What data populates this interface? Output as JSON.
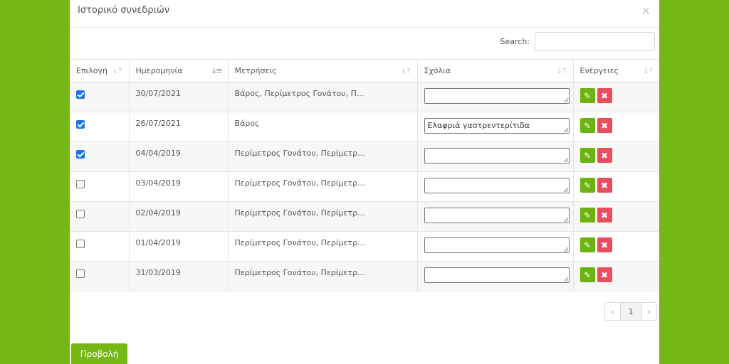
{
  "modal": {
    "title": "Ιστορικό συνεδριών",
    "close_icon": "×"
  },
  "search": {
    "label": "Search:",
    "value": "",
    "placeholder": ""
  },
  "table": {
    "columns": [
      "Επιλογή",
      "Ημερομηνία",
      "Μετρήσεις",
      "Σχόλια",
      "Ενέργειες"
    ],
    "rows": [
      {
        "checked": true,
        "date": "30/07/2021",
        "measurements": "Βάρος, Περίμετρος Γονάτου, Π...",
        "comment": ""
      },
      {
        "checked": true,
        "date": "26/07/2021",
        "measurements": "Βάρος",
        "comment": "Ελαφριά γαστρεντερίτιδα"
      },
      {
        "checked": true,
        "date": "04/04/2019",
        "measurements": "Περίμετρος Γονάτου, Περίμετρ...",
        "comment": ""
      },
      {
        "checked": false,
        "date": "03/04/2019",
        "measurements": "Περίμετρος Γονάτου, Περίμετρ...",
        "comment": ""
      },
      {
        "checked": false,
        "date": "02/04/2019",
        "measurements": "Περίμετρος Γονάτου, Περίμετρ...",
        "comment": ""
      },
      {
        "checked": false,
        "date": "01/04/2019",
        "measurements": "Περίμετρος Γονάτου, Περίμετρ...",
        "comment": ""
      },
      {
        "checked": false,
        "date": "31/03/2019",
        "measurements": "Περίμετρος Γονάτου, Περίμετρ...",
        "comment": ""
      }
    ],
    "actions": {
      "edit_icon": "pencil-icon",
      "delete_icon": "times-icon"
    }
  },
  "pagination": {
    "prev": "‹",
    "current": "1",
    "next": "›"
  },
  "footer": {
    "view_button_label": "Προβολή"
  },
  "colors": {
    "background": "#74b816",
    "edit": "#6cb30f",
    "delete": "#e84d60",
    "checkbox": "#1a73e8"
  }
}
